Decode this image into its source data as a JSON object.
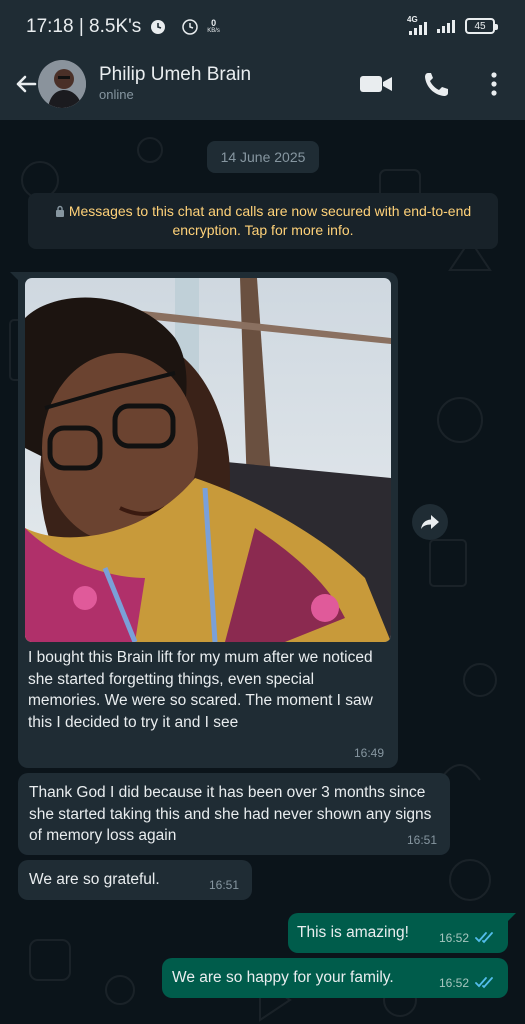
{
  "status_bar": {
    "time_speed": "17:18 | 8.5K's",
    "net_speed_value": "0",
    "net_speed_unit": "KB/s",
    "network_type": "4G",
    "battery": "45"
  },
  "header": {
    "contact_name": "Philip Umeh Brain",
    "contact_status": "online",
    "icons": [
      "back-arrow-icon",
      "video-call-icon",
      "phone-icon",
      "more-vert-icon"
    ]
  },
  "chat": {
    "date_chip": "14 June 2025",
    "encryption_notice": "Messages to this chat and calls are now secured with end-to-end encryption. Tap for more info.",
    "messages": [
      {
        "direction": "incoming",
        "has_image": true,
        "text": "I bought this Brain lift for my mum after we noticed she started forgetting things, even special memories. We were so scared. The moment I saw this I decided to try it and I see",
        "time": "16:49"
      },
      {
        "direction": "incoming",
        "text": "Thank God I did because it has been over 3 months since she started taking this and she had never shown any signs of memory loss again",
        "time": "16:51"
      },
      {
        "direction": "incoming",
        "text": "We are so grateful.",
        "time": "16:51"
      },
      {
        "direction": "outgoing",
        "text": "This is amazing!",
        "time": "16:52",
        "read": true
      },
      {
        "direction": "outgoing",
        "text": "We are so happy for your family.",
        "time": "16:52",
        "read": true
      }
    ]
  },
  "colors": {
    "background": "#0b141a",
    "bar": "#1f2c34",
    "incoming_bubble": "#1f2c34",
    "outgoing_bubble": "#005c4b",
    "encryption_text": "#ffd279",
    "read_ticks": "#53bdeb"
  }
}
